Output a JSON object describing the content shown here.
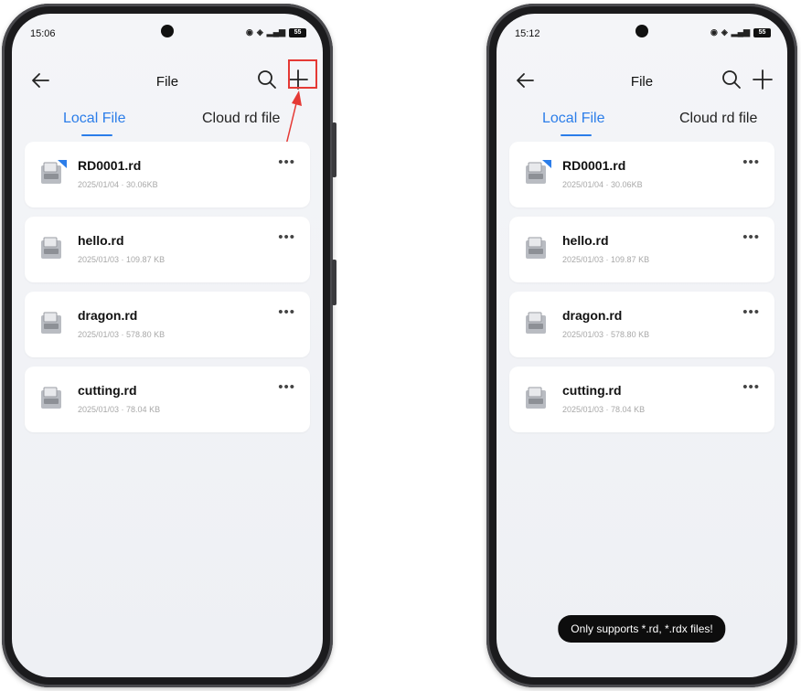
{
  "left_screen": {
    "status": {
      "time": "15:06",
      "battery": "55"
    },
    "appbar": {
      "title": "File"
    },
    "tabs": [
      {
        "label": "Local File",
        "active": true
      },
      {
        "label": "Cloud rd file",
        "active": false
      }
    ],
    "files": [
      {
        "name": "RD0001.rd",
        "meta": "2025/01/04 · 30.06KB",
        "badge": true
      },
      {
        "name": "hello.rd",
        "meta": "2025/01/03 · 109.87 KB",
        "badge": false
      },
      {
        "name": "dragon.rd",
        "meta": "2025/01/03 · 578.80 KB",
        "badge": false
      },
      {
        "name": "cutting.rd",
        "meta": "2025/01/03 · 78.04 KB",
        "badge": false
      }
    ]
  },
  "right_screen": {
    "status": {
      "time": "15:12",
      "battery": "55"
    },
    "appbar": {
      "title": "File"
    },
    "tabs": [
      {
        "label": "Local File",
        "active": true
      },
      {
        "label": "Cloud rd file",
        "active": false
      }
    ],
    "files": [
      {
        "name": "RD0001.rd",
        "meta": "2025/01/04 · 30.06KB",
        "badge": true
      },
      {
        "name": "hello.rd",
        "meta": "2025/01/03 · 109.87 KB",
        "badge": false
      },
      {
        "name": "dragon.rd",
        "meta": "2025/01/03 · 578.80 KB",
        "badge": false
      },
      {
        "name": "cutting.rd",
        "meta": "2025/01/03 · 78.04 KB",
        "badge": false
      }
    ],
    "toast": "Only supports *.rd, *.rdx files!"
  },
  "icons": {
    "back": "arrow-left-icon",
    "search": "search-icon",
    "add": "plus-icon",
    "file": "document-file-icon",
    "more": "more-horizontal-icon",
    "badge": "new-badge-icon"
  },
  "colors": {
    "accent": "#2b7de9",
    "highlight": "#e53935",
    "toast_bg": "#0d0d0d",
    "background": "#f4f5f8"
  }
}
